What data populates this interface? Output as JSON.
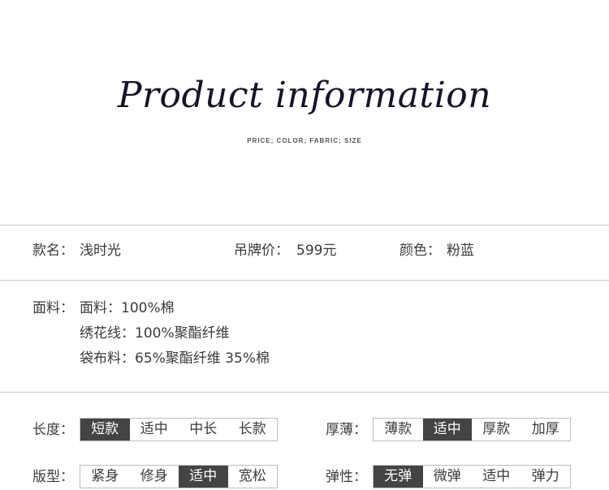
{
  "header": {
    "title": "Product information",
    "subtitle": "PRICE; COLOR; FABRIC; SIZE"
  },
  "info": {
    "name_label": "款名：",
    "name_value": "浅时光",
    "price_label": "吊牌价：",
    "price_value": "599元",
    "color_label": "颜色：",
    "color_value": "粉蓝"
  },
  "fabric": {
    "label": "面料：",
    "lines": [
      "面料：100%棉",
      "绣花线：100%聚酯纤维",
      "袋布料：65%聚酯纤维 35%棉"
    ]
  },
  "attributes": {
    "length": {
      "label": "长度：",
      "options": [
        "短款",
        "适中",
        "中长",
        "长款"
      ],
      "selected": "短款"
    },
    "thickness": {
      "label": "厚薄：",
      "options": [
        "薄款",
        "适中",
        "厚款",
        "加厚"
      ],
      "selected": "适中"
    },
    "fit": {
      "label": "版型：",
      "options": [
        "紧身",
        "修身",
        "适中",
        "宽松"
      ],
      "selected": "适中"
    },
    "elasticity": {
      "label": "弹性：",
      "options": [
        "无弹",
        "微弹",
        "适中",
        "弹力"
      ],
      "selected": "无弹"
    }
  }
}
